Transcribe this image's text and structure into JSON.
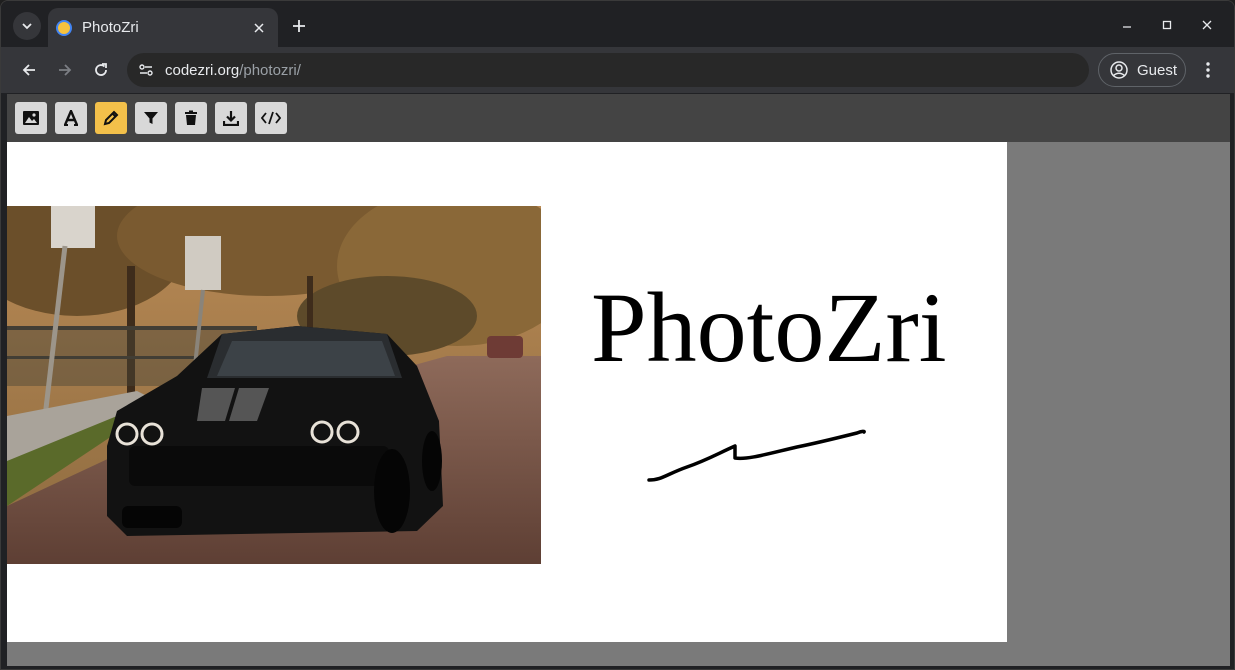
{
  "browser": {
    "tab_title": "PhotoZri",
    "url_domain": "codezri.org",
    "url_path": "/photozri/",
    "profile_label": "Guest"
  },
  "app": {
    "tools": [
      {
        "name": "image",
        "icon": "image-icon",
        "active": false
      },
      {
        "name": "text",
        "icon": "text-icon",
        "active": false
      },
      {
        "name": "draw",
        "icon": "pencil-icon",
        "active": true
      },
      {
        "name": "filter",
        "icon": "filter-icon",
        "active": false
      },
      {
        "name": "delete",
        "icon": "trash-icon",
        "active": false
      },
      {
        "name": "download",
        "icon": "download-icon",
        "active": false
      },
      {
        "name": "code",
        "icon": "code-icon",
        "active": false
      }
    ],
    "active_color": "#f3c04a"
  },
  "canvas": {
    "text_object": "PhotoZri"
  }
}
